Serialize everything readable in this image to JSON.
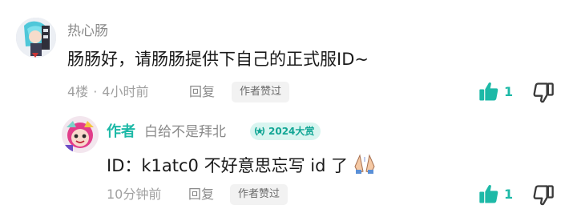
{
  "comment": {
    "username": "热心肠",
    "text": "肠肠好，请肠肠提供下自己的正式服ID~",
    "floor": "4楼",
    "separator": "·",
    "time": "4小时前",
    "reply_label": "回复",
    "author_liked": "作者赞过",
    "like_count": "1"
  },
  "reply": {
    "author_tag": "作者",
    "username": "白给不是拜北",
    "badge": "2024大赏",
    "text": "ID：k1atc0 不好意思忘写 id 了",
    "emoji": "pray-hands-emoji",
    "time": "10分钟前",
    "reply_label": "回复",
    "author_liked": "作者赞过",
    "like_count": "1"
  },
  "colors": {
    "accent": "#1db9a7",
    "thumb_up": "#1db9a7",
    "thumb_down": "#3a3a3a",
    "chip_bg": "#f2f2f2",
    "badge_bg": "#d9f5f0"
  },
  "icons": [
    "thumbs-up-icon",
    "thumbs-down-icon",
    "laurel-badge-icon"
  ]
}
